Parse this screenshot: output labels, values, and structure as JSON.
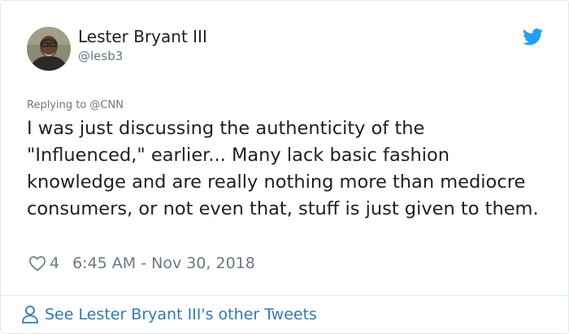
{
  "tweet": {
    "author_name": "Lester Bryant III",
    "author_handle": "@lesb3",
    "replying_to": "Replying to @CNN",
    "text": "I was just discussing the authenticity of the \"Influenced,\" earlier... Many lack basic fashion knowledge and are really nothing more than mediocre consumers, or not even that, stuff is just given to them.",
    "like_count": "4",
    "timestamp": "6:45 AM - Nov 30, 2018"
  },
  "footer": {
    "link_label": "See Lester Bryant III's other Tweets"
  },
  "icons": {
    "brand": "twitter-bird-icon",
    "like": "heart-icon",
    "profile": "person-icon"
  },
  "colors": {
    "twitter_blue": "#1da1f2",
    "link_blue": "#2b7bb9",
    "secondary_text": "#697882",
    "primary_text": "#1c2022",
    "border": "#e1e8ed"
  }
}
